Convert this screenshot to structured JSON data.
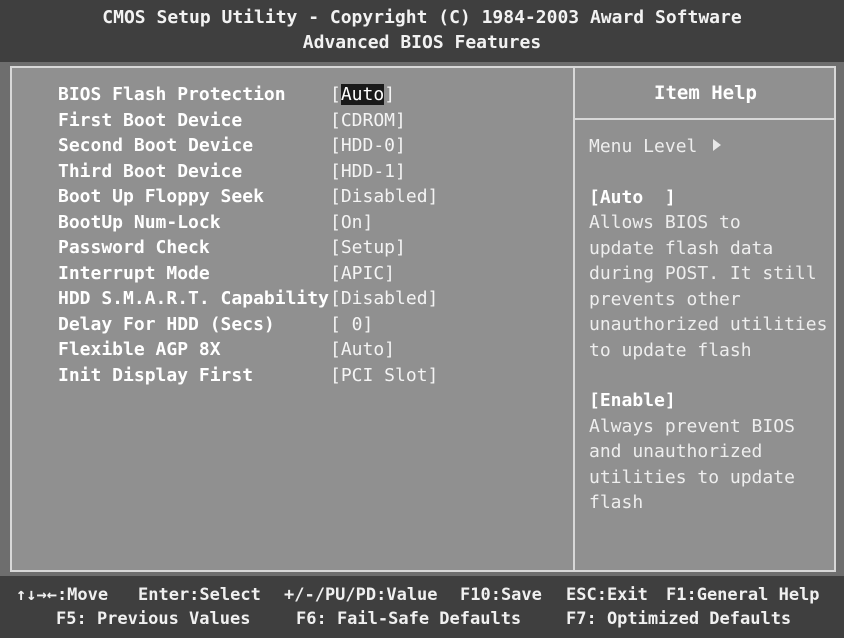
{
  "header": {
    "title_line1": "CMOS Setup Utility - Copyright (C) 1984-2003 Award Software",
    "title_line2": "Advanced BIOS Features"
  },
  "settings": [
    {
      "label": "BIOS Flash Protection",
      "value_prefix": "[",
      "value_highlight": "Auto",
      "value_suffix": "]",
      "selected": true
    },
    {
      "label": "First Boot Device",
      "value": "[CDROM]"
    },
    {
      "label": "Second Boot Device",
      "value": "[HDD-0]"
    },
    {
      "label": "Third Boot Device",
      "value": "[HDD-1]"
    },
    {
      "label": "Boot Up Floppy Seek",
      "value": "[Disabled]"
    },
    {
      "label": "BootUp Num-Lock",
      "value": "[On]"
    },
    {
      "label": "Password Check",
      "value": "[Setup]"
    },
    {
      "label": "Interrupt Mode",
      "value": "[APIC]"
    },
    {
      "label": "HDD S.M.A.R.T. Capability",
      "value": "[Disabled]"
    },
    {
      "label": "Delay For HDD (Secs)",
      "value": "[ 0]"
    },
    {
      "label": "Flexible AGP 8X",
      "value": "[Auto]"
    },
    {
      "label": "Init Display First",
      "value": "[PCI Slot]"
    }
  ],
  "help": {
    "title": "Item Help",
    "menu_level": "Menu Level",
    "menu_level_icon": "arrow-right-icon",
    "auto_heading": "[Auto  ]",
    "auto_lines": [
      "Allows BIOS to",
      "update flash data",
      "during POST. It still",
      "prevents other",
      "unauthorized utilities",
      "to update flash"
    ],
    "enable_heading": "[Enable]",
    "enable_lines": [
      "Always prevent BIOS",
      "and unauthorized",
      "utilities to update",
      "flash"
    ]
  },
  "footer": {
    "move": "↑↓→←:Move",
    "enter": "Enter:Select",
    "value": "+/-/PU/PD:Value",
    "save": "F10:Save",
    "exit": "ESC:Exit",
    "general_help": "F1:General Help",
    "previous_values": "F5: Previous Values",
    "fail_safe": "F6: Fail-Safe Defaults",
    "optimized": "F7: Optimized Defaults"
  }
}
